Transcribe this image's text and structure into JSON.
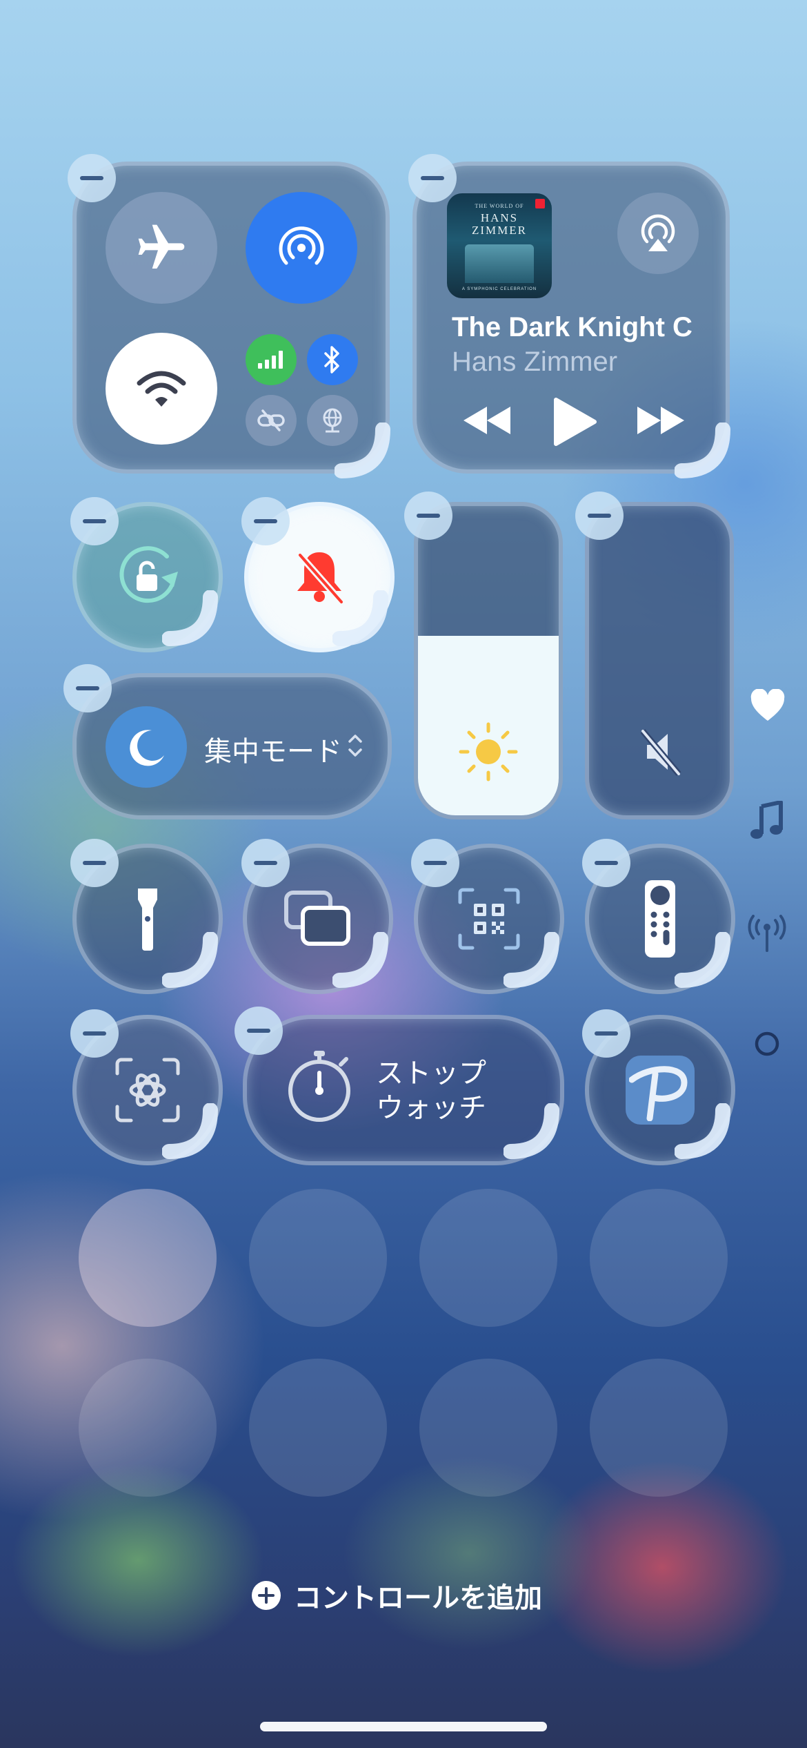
{
  "now_playing": {
    "title": "The Dark Knight C",
    "artist": "Hans Zimmer",
    "album_art_text": {
      "top": "THE WORLD OF",
      "name1": "HANS",
      "name2": "ZIMMER",
      "bottom": "A SYMPHONIC CELEBRATION"
    }
  },
  "focus": {
    "label": "集中モード"
  },
  "stopwatch": {
    "label_line1": "ストップ",
    "label_line2": "ウォッチ"
  },
  "add_controls": {
    "label": "コントロールを追加"
  },
  "brightness": {
    "level": 0.58
  },
  "volume": {
    "level": 0.0
  },
  "colors": {
    "accent_blue": "#2f7bf0",
    "cellular_green": "#3fbf5b",
    "bell_red": "#ff3b30",
    "sun_yellow": "#f6c945"
  },
  "side_icons": [
    "heart-icon",
    "music-note-icon",
    "antenna-icon",
    "circle-icon"
  ]
}
